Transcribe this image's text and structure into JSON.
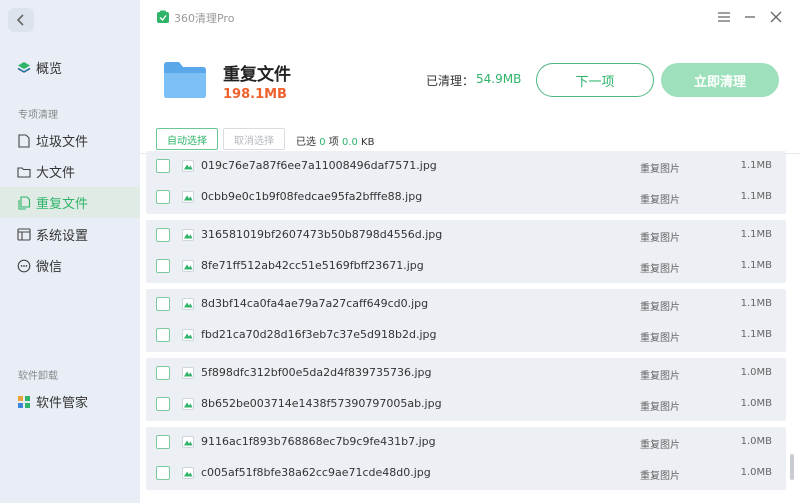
{
  "app": {
    "name": "360清理Pro"
  },
  "sidebar": {
    "items": [
      {
        "label": "概览",
        "icon": "layers-icon"
      },
      {
        "label": "垃圾文件",
        "icon": "file-icon"
      },
      {
        "label": "大文件",
        "icon": "folder-icon"
      },
      {
        "label": "重复文件",
        "icon": "files-icon",
        "active": true
      },
      {
        "label": "系统设置",
        "icon": "window-icon"
      },
      {
        "label": "微信",
        "icon": "chat-icon"
      },
      {
        "label": "软件管家",
        "icon": "grid-icon"
      }
    ],
    "sections": {
      "special": "专项清理",
      "uninstall": "软件卸载"
    }
  },
  "header": {
    "title": "重复文件",
    "size": "198.1MB",
    "cleaned_label": "已清理：",
    "cleaned_value": "54.9MB",
    "next_label": "下一项",
    "clean_label": "立即清理"
  },
  "toolbar": {
    "auto_select": "自动选择",
    "cancel_select": "取消选择",
    "selected_prefix": "已选",
    "selected_count": "0",
    "selected_unit": "项",
    "selected_size": "0.0",
    "selected_size_unit": "KB"
  },
  "files": [
    {
      "name": "019c76e7a87f6ee7a11008496daf7571.jpg",
      "type": "重复图片",
      "size": "1.1MB"
    },
    {
      "name": "0cbb9e0c1b9f08fedcae95fa2bfffe88.jpg",
      "type": "重复图片",
      "size": "1.1MB"
    },
    {
      "name": "316581019bf2607473b50b8798d4556d.jpg",
      "type": "重复图片",
      "size": "1.1MB"
    },
    {
      "name": "8fe71ff512ab42cc51e5169fbff23671.jpg",
      "type": "重复图片",
      "size": "1.1MB"
    },
    {
      "name": "8d3bf14ca0fa4ae79a7a27caff649cd0.jpg",
      "type": "重复图片",
      "size": "1.1MB"
    },
    {
      "name": "fbd21ca70d28d16f3eb7c37e5d918b2d.jpg",
      "type": "重复图片",
      "size": "1.1MB"
    },
    {
      "name": "5f898dfc312bf00e5da2d4f839735736.jpg",
      "type": "重复图片",
      "size": "1.0MB"
    },
    {
      "name": "8b652be003714e1438f57390797005ab.jpg",
      "type": "重复图片",
      "size": "1.0MB"
    },
    {
      "name": "9116ac1f893b768868ec7b9c9fe431b7.jpg",
      "type": "重复图片",
      "size": "1.0MB"
    },
    {
      "name": "c005af51f8bfe38a62cc9ae71cde48d0.jpg",
      "type": "重复图片",
      "size": "1.0MB"
    }
  ],
  "colors": {
    "accent": "#2fb46a",
    "size_highlight": "#f0622b",
    "clean_button": "#9de0bb"
  }
}
